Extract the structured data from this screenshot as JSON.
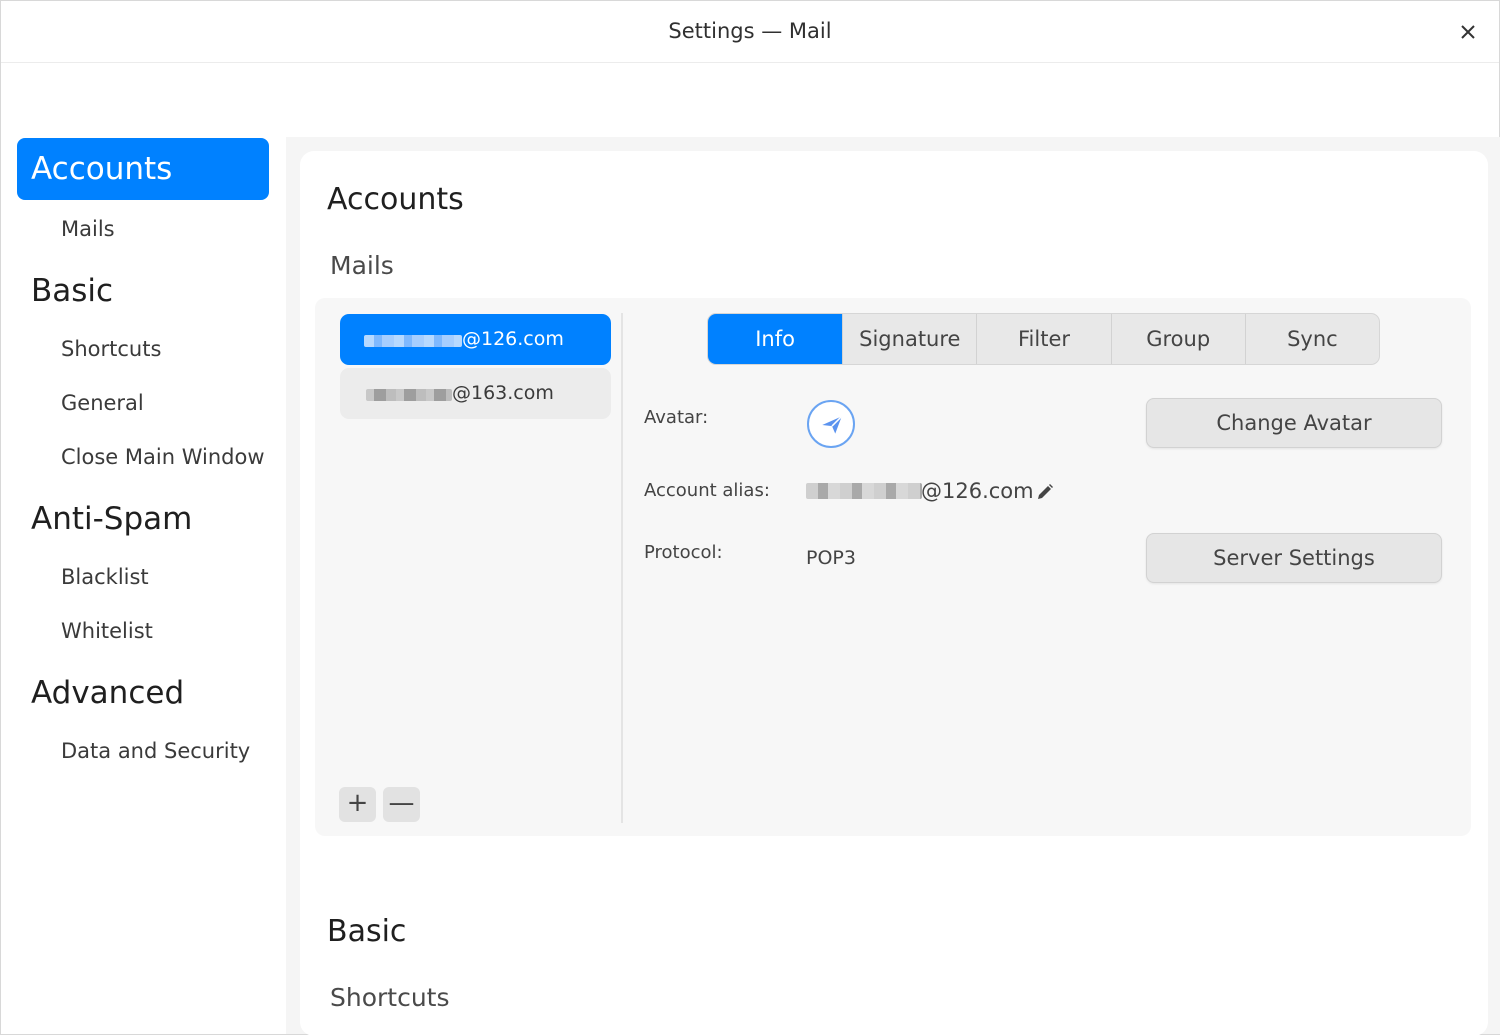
{
  "window": {
    "title": "Settings — Mail"
  },
  "sidebar": {
    "categories": [
      {
        "label": "Accounts",
        "items": [
          "Mails"
        ]
      },
      {
        "label": "Basic",
        "items": [
          "Shortcuts",
          "General",
          "Close Main Window"
        ]
      },
      {
        "label": "Anti-Spam",
        "items": [
          "Blacklist",
          "Whitelist"
        ]
      },
      {
        "label": "Advanced",
        "items": [
          "Data and Security"
        ]
      }
    ],
    "active": "Accounts"
  },
  "main": {
    "section_title": "Accounts",
    "section_subtitle": "Mails",
    "accounts": [
      {
        "email_suffix": "@126.com",
        "selected": true
      },
      {
        "email_suffix": "@163.com",
        "selected": false
      }
    ],
    "add_label": "+",
    "remove_label": "—",
    "tabs": [
      "Info",
      "Signature",
      "Filter",
      "Group",
      "Sync"
    ],
    "active_tab": "Info",
    "info": {
      "avatar_label": "Avatar:",
      "alias_label": "Account alias:",
      "alias_value_suffix": "@126.com",
      "protocol_label": "Protocol:",
      "protocol_value": "POP3",
      "change_avatar_button": "Change Avatar",
      "server_settings_button": "Server Settings"
    },
    "next_section_title": "Basic",
    "next_section_subtitle": "Shortcuts"
  },
  "colors": {
    "accent": "#0081ff"
  }
}
